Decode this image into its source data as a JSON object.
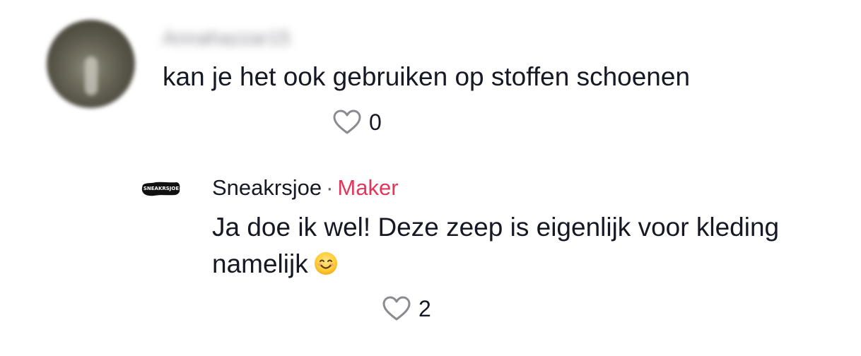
{
  "comment": {
    "username": "Annahazzar15",
    "text": "kan je het ook gebruiken op stoffen schoenen",
    "like_icon": "heart-outline-icon",
    "like_count": "0"
  },
  "reply": {
    "avatar_text": "SNEAKRSJOE",
    "username": "Sneakrsjoe",
    "separator": "·",
    "badge": "Maker",
    "text": "Ja doe ik wel! Deze zeep is eigenlijk voor kleding namelijk",
    "emoji": "smiling-face-icon",
    "like_icon": "heart-outline-icon",
    "like_count": "2"
  },
  "colors": {
    "text": "#161823",
    "creator_badge": "#e3375a",
    "muted": "#8a8b91"
  }
}
